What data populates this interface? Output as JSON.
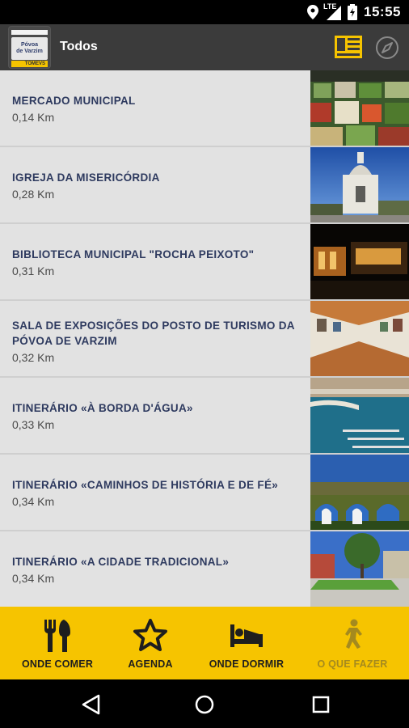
{
  "status_bar": {
    "time": "15:55",
    "network": "LTE"
  },
  "app_bar": {
    "title": "Todos",
    "logo": {
      "line1": "Póvoa",
      "line2": "de Varzim",
      "badge": "TOMEVS"
    }
  },
  "places": [
    {
      "title": "MERCADO MUNICIPAL",
      "distance": "0,14 Km"
    },
    {
      "title": "IGREJA DA MISERICÓRDIA",
      "distance": "0,28 Km"
    },
    {
      "title": "BIBLIOTECA MUNICIPAL \"ROCHA PEIXOTO\"",
      "distance": "0,31 Km"
    },
    {
      "title": "SALA DE EXPOSIÇÕES DO POSTO DE TURISMO DA PÓVOA DE VARZIM",
      "distance": "0,32 Km"
    },
    {
      "title": "ITINERÁRIO «À BORDA D'ÁGUA»",
      "distance": "0,33 Km"
    },
    {
      "title": "ITINERÁRIO «CAMINHOS DE HISTÓRIA E DE FÉ»",
      "distance": "0,34 Km"
    },
    {
      "title": "ITINERÁRIO «A CIDADE TRADICIONAL»",
      "distance": "0,34 Km"
    }
  ],
  "bottom_nav": {
    "items": [
      {
        "label": "ONDE COMER",
        "icon": "fork-knife-icon"
      },
      {
        "label": "AGENDA",
        "icon": "star-icon"
      },
      {
        "label": "ONDE DORMIR",
        "icon": "bed-icon"
      },
      {
        "label": "O QUE FAZER",
        "icon": "walking-person-icon"
      }
    ]
  },
  "colors": {
    "accent": "#f6c400",
    "app_bar": "#3b3b3b",
    "title_text": "#2e3a5f",
    "active_nav": "#a58a1e"
  }
}
